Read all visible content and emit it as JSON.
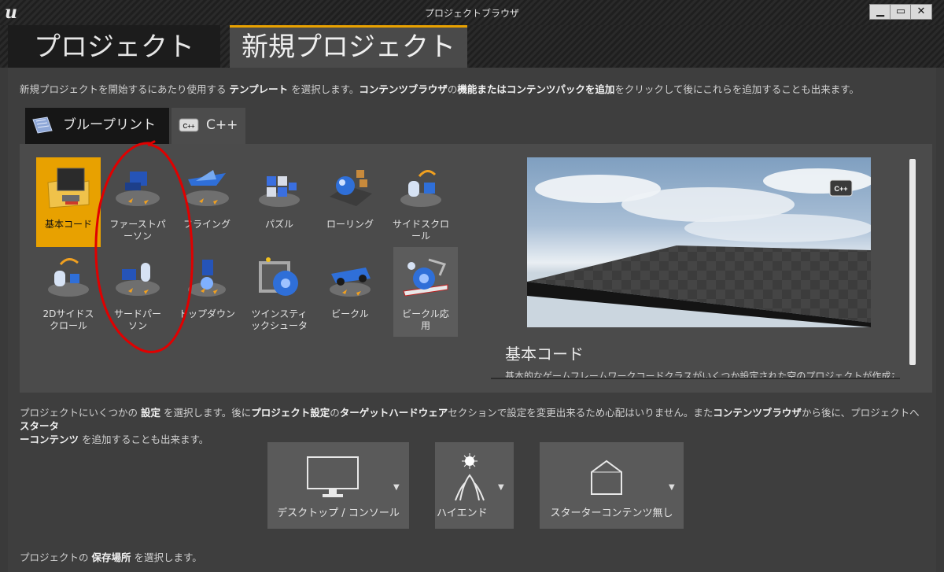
{
  "window": {
    "title": "プロジェクトブラウザ",
    "logo_text": "u",
    "minimize_symbol": "▁",
    "maximize_symbol": "▭",
    "close_symbol": "✕"
  },
  "main_tabs": [
    {
      "label": "プロジェクト",
      "active": false
    },
    {
      "label": "新規プロジェクト",
      "active": true
    }
  ],
  "intro": {
    "part1": "新規プロジェクトを開始するにあたり使用する ",
    "bold1": "テンプレート",
    "part2": " を選択します。",
    "bold2": "コンテンツブラウザ",
    "part3": "の",
    "bold3": "機能またはコンテンツパックを追加",
    "part4": "をクリックして後にこれらを追加することも出来ます。"
  },
  "sub_tabs": [
    {
      "label": "ブループリント",
      "icon": "blueprint-icon",
      "active": true
    },
    {
      "label": "C++",
      "icon": "cpp-icon",
      "active": false
    }
  ],
  "templates": [
    {
      "label": "基本コード",
      "icon": "basic-code-icon",
      "selected": true
    },
    {
      "label": "ファーストパーソン",
      "icon": "first-person-icon"
    },
    {
      "label": "フライング",
      "icon": "flying-icon"
    },
    {
      "label": "パズル",
      "icon": "puzzle-icon"
    },
    {
      "label": "ローリング",
      "icon": "rolling-icon"
    },
    {
      "label": "サイドスクロール",
      "icon": "side-scroll-icon"
    },
    {
      "label": "2Dサイドスクロール",
      "icon": "side-scroll-2d-icon"
    },
    {
      "label": "サードパーソン",
      "icon": "third-person-icon"
    },
    {
      "label": "トップダウン",
      "icon": "top-down-icon"
    },
    {
      "label": "ツインスティックシュータ",
      "icon": "twin-stick-icon"
    },
    {
      "label": "ビークル",
      "icon": "vehicle-icon"
    },
    {
      "label": "ビークル応用",
      "icon": "vehicle-advanced-icon",
      "hover": true
    }
  ],
  "template_lines": {
    "t1": [
      "ファーストパ",
      "ーソン"
    ],
    "t5": [
      "サイドスクロ",
      "ール"
    ],
    "t6": [
      "2Dサイドス",
      "クロール"
    ],
    "t7": [
      "サードパー",
      "ソン"
    ],
    "t9": [
      "ツインスティ",
      "ックシュータ"
    ],
    "t11": [
      "ビークル応",
      "用"
    ]
  },
  "preview": {
    "title": "基本コード",
    "description": "基本的なゲームフレームワークコードクラスがいくつか設定された空のプロジェクトが作成されます。",
    "badge": "C++"
  },
  "settings_intro": {
    "part1": "プロジェクトにいくつかの ",
    "bold1": "設定",
    "part2": " を選択します。後に",
    "bold2": "プロジェクト設定",
    "part3": "の",
    "bold3": "ターゲットハードウェア",
    "part4": "セクションで設定を変更出来るため心配はいりません。また",
    "bold4": "コンテンツブラウザ",
    "part5": "から後に、プロジェクトへ ",
    "bold5": "スターターコンテンツ",
    "part6": " を追加することも出来ます。",
    "bold5a": "スタータ",
    "bold5b": "ーコンテンツ"
  },
  "settings": [
    {
      "label": "デスクトップ / コンソール",
      "icon": "monitor-icon"
    },
    {
      "label": "ハイエンド",
      "icon": "high-end-icon"
    },
    {
      "label": "スターターコンテンツ無し",
      "icon": "empty-box-icon"
    }
  ],
  "location_intro": {
    "part1": "プロジェクトの ",
    "bold1": "保存場所",
    "part2": " を選択します。"
  },
  "colors": {
    "accent": "#e8a100",
    "annotation": "#e00000"
  }
}
